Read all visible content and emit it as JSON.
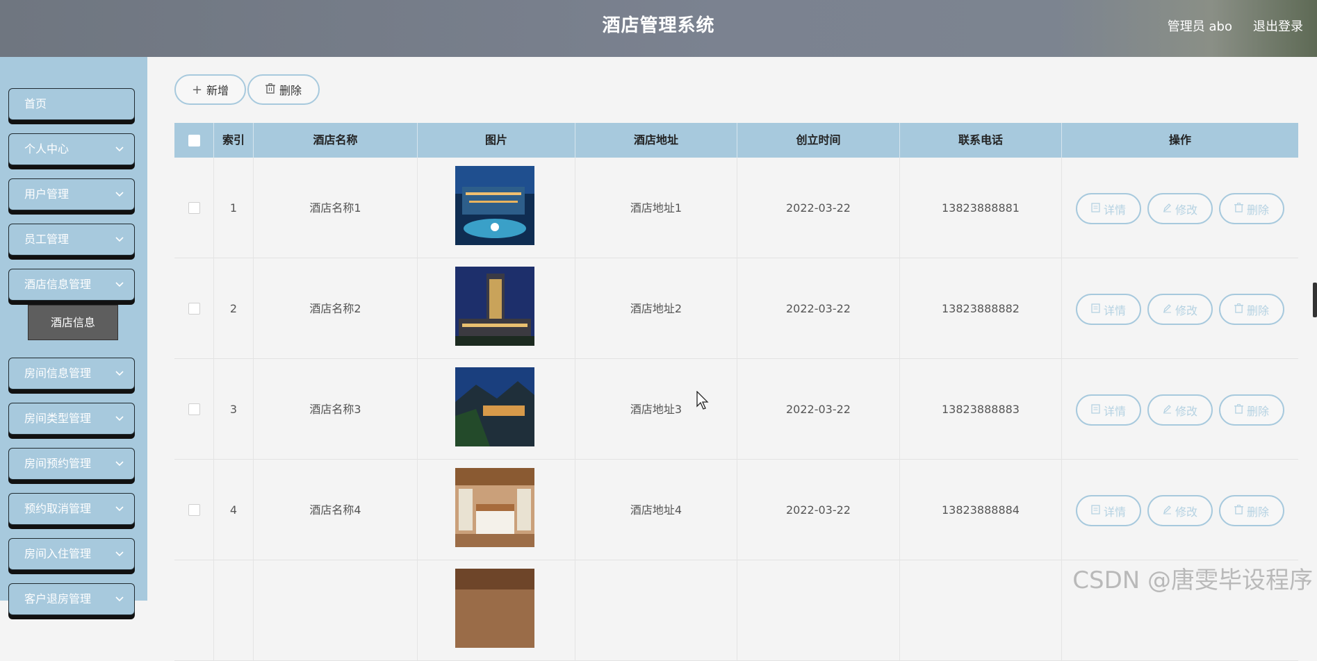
{
  "header": {
    "title": "酒店管理系统",
    "user": "管理员 abo",
    "logout": "退出登录"
  },
  "sidebar": {
    "items": [
      {
        "label": "首页",
        "has_chevron": false
      },
      {
        "label": "个人中心",
        "has_chevron": true
      },
      {
        "label": "用户管理",
        "has_chevron": true
      },
      {
        "label": "员工管理",
        "has_chevron": true
      },
      {
        "label": "酒店信息管理",
        "has_chevron": true
      },
      {
        "label": "房间信息管理",
        "has_chevron": true
      },
      {
        "label": "房间类型管理",
        "has_chevron": true
      },
      {
        "label": "房间预约管理",
        "has_chevron": true
      },
      {
        "label": "预约取消管理",
        "has_chevron": true
      },
      {
        "label": "房间入住管理",
        "has_chevron": true
      },
      {
        "label": "客户退房管理",
        "has_chevron": true
      }
    ],
    "submenu_active": "酒店信息"
  },
  "toolbar": {
    "add_label": "新增",
    "delete_label": "删除"
  },
  "table": {
    "columns": [
      "",
      "索引",
      "酒店名称",
      "图片",
      "酒店地址",
      "创立时间",
      "联系电话",
      "操作"
    ],
    "rows": [
      {
        "index": "1",
        "name": "酒店名称1",
        "address": "酒店地址1",
        "date": "2022-03-22",
        "phone": "13823888881",
        "image": "hotel-night-pool"
      },
      {
        "index": "2",
        "name": "酒店名称2",
        "address": "酒店地址2",
        "date": "2022-03-22",
        "phone": "13823888882",
        "image": "hotel-tower-dusk"
      },
      {
        "index": "3",
        "name": "酒店名称3",
        "address": "酒店地址3",
        "date": "2022-03-22",
        "phone": "13823888883",
        "image": "hotel-mountain-night"
      },
      {
        "index": "4",
        "name": "酒店名称4",
        "address": "酒店地址4",
        "date": "2022-03-22",
        "phone": "13823888884",
        "image": "hotel-room-wood"
      },
      {
        "index": "",
        "name": "",
        "address": "",
        "date": "",
        "phone": "",
        "image": "hotel-room-partial"
      }
    ],
    "actions": {
      "detail": "详情",
      "edit": "修改",
      "delete": "删除"
    }
  },
  "watermark": "CSDN @唐雯毕设程序",
  "colors": {
    "accent": "#a7c9dd",
    "header": "#7b8290",
    "submenu": "#5e5e5e"
  }
}
